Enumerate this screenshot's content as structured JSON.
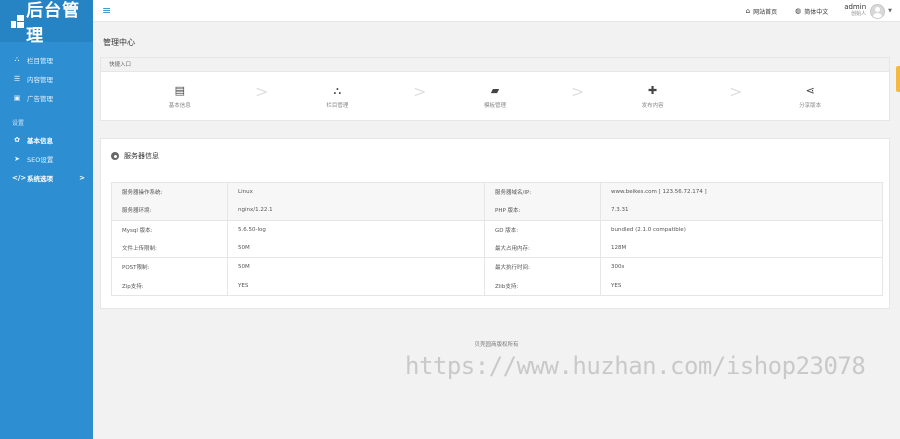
{
  "app": {
    "logo_text": "后台管理"
  },
  "sidebar": {
    "items": [
      {
        "icon": "sitemap-icon",
        "glyph": "⛬",
        "label": "栏目管理"
      },
      {
        "icon": "list-icon",
        "glyph": "☰",
        "label": "内容管理"
      },
      {
        "icon": "image-icon",
        "glyph": "▣",
        "label": "广告管理"
      }
    ],
    "group_label": "设置",
    "settings_items": [
      {
        "icon": "gear-icon",
        "glyph": "✿",
        "label": "基本信息"
      },
      {
        "icon": "send-icon",
        "glyph": "➤",
        "label": "SEO设置"
      },
      {
        "icon": "code-icon",
        "glyph": "</>",
        "label": "系统选项",
        "arrow": ">"
      }
    ]
  },
  "topbar": {
    "menu_glyph": "≡",
    "home_label": "网站首页",
    "lang_label": "简体中文",
    "user_name": "admin",
    "user_role": "创始人"
  },
  "main": {
    "page_title": "管理中心",
    "quick": {
      "header": "快捷入口",
      "items": [
        {
          "label": "基本信息",
          "glyph": "▤"
        },
        {
          "label": "栏目管理",
          "glyph": "⛬"
        },
        {
          "label": "模板管理",
          "glyph": "▰"
        },
        {
          "label": "发布内容",
          "glyph": "✚"
        },
        {
          "label": "分享版本",
          "glyph": "⋖"
        }
      ],
      "separator": ">"
    },
    "info": {
      "title": "服务器信息",
      "rows": [
        {
          "k1": "服务器操作系统:",
          "v1": "Linux",
          "k2": "服务器域名/IP:",
          "v2": "www.beikes.com [ 123.56.72.174 ]"
        },
        {
          "k1": "服务器环境:",
          "v1": "nginx/1.22.1",
          "k2": "PHP 版本:",
          "v2": "7.3.31"
        },
        {
          "k1": "Mysql 版本:",
          "v1": "5.6.50-log",
          "k2": "GD 版本:",
          "v2": "bundled (2.1.0 compatible)"
        },
        {
          "k1": "文件上传限制:",
          "v1": "50M",
          "k2": "最大占用内存:",
          "v2": "128M"
        },
        {
          "k1": "POST限制:",
          "v1": "50M",
          "k2": "最大执行时间:",
          "v2": "300s"
        },
        {
          "k1": "Zip支持:",
          "v1": "YES",
          "k2": "Zlib支持:",
          "v2": "YES"
        }
      ]
    },
    "footer": "贝壳园商版权所有",
    "watermark": "https://www.huzhan.com/ishop23078"
  }
}
